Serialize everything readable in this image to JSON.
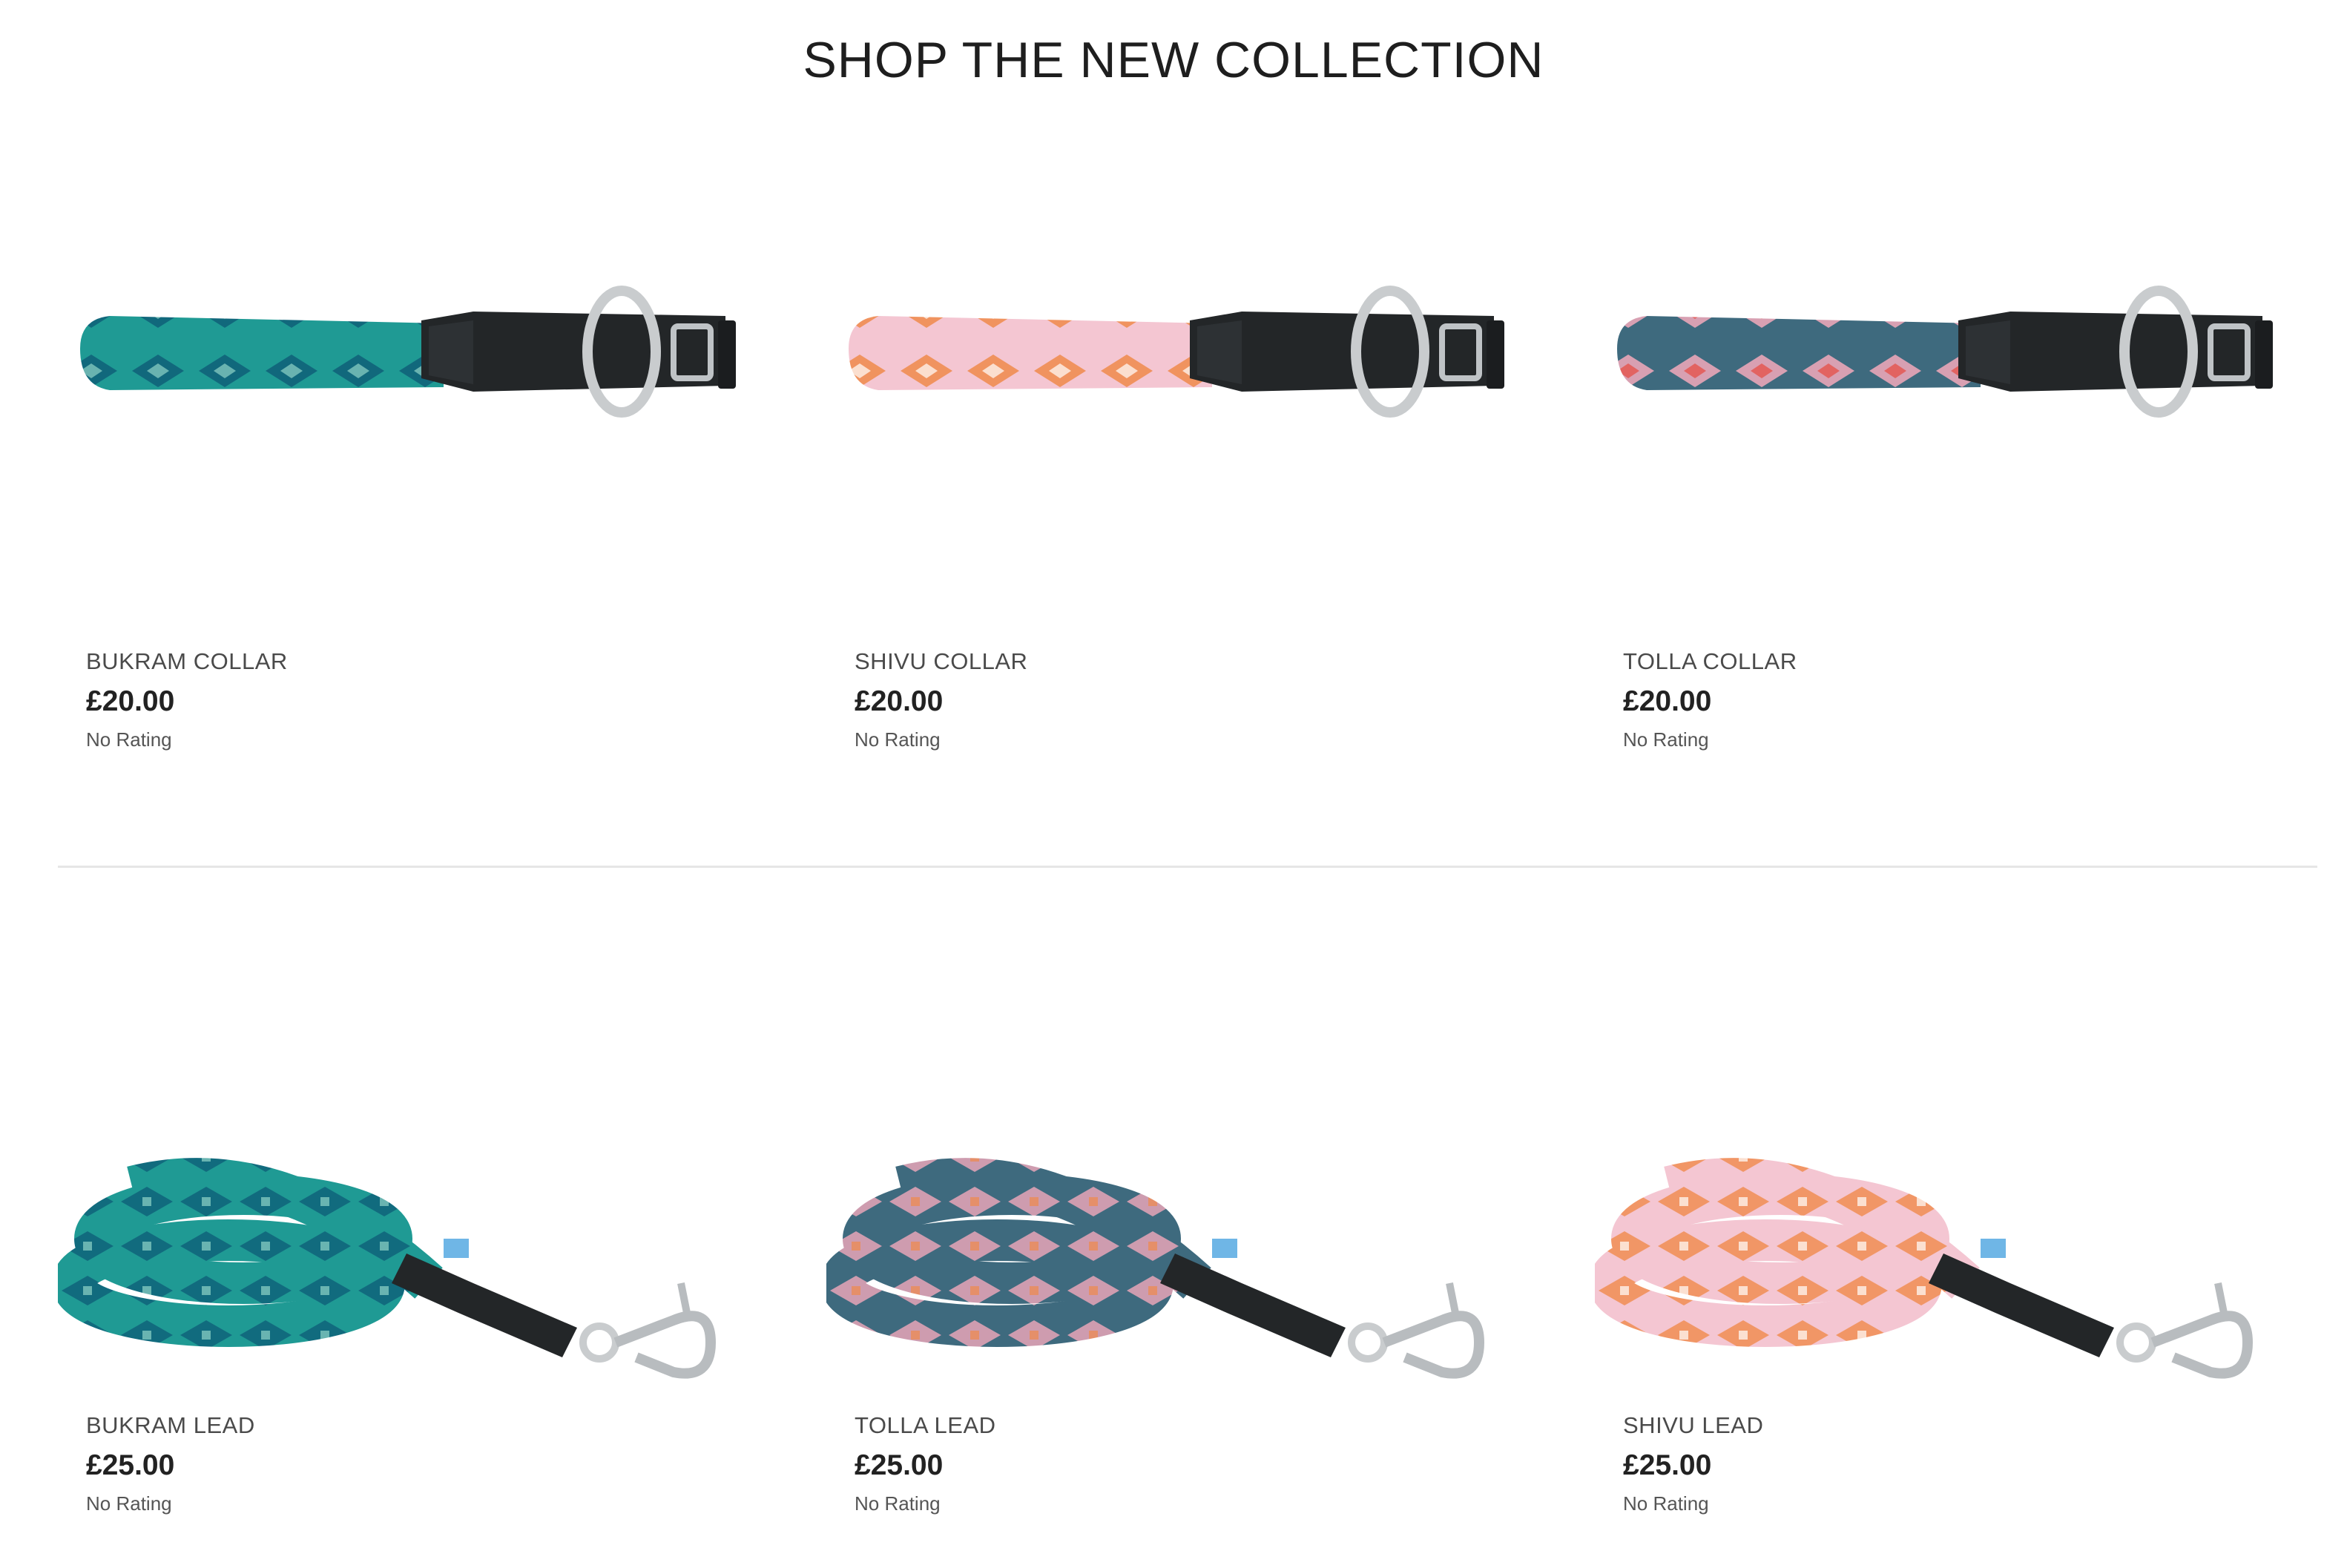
{
  "section": {
    "title": "SHOP THE NEW COLLECTION"
  },
  "products": [
    {
      "name": "BUKRAM COLLAR",
      "price": "£20.00",
      "rating": "No Rating",
      "type": "collar",
      "colors": {
        "fabric": "#1f9a94",
        "pattern": "#0e5f78",
        "accent": "#8fd3c6"
      }
    },
    {
      "name": "SHIVU COLLAR",
      "price": "£20.00",
      "rating": "No Rating",
      "type": "collar",
      "colors": {
        "fabric": "#f4c6d2",
        "pattern": "#f08a4b",
        "accent": "#ffffff"
      }
    },
    {
      "name": "TOLLA COLLAR",
      "price": "£20.00",
      "rating": "No Rating",
      "type": "collar",
      "colors": {
        "fabric": "#3e6a7e",
        "pattern": "#f3a9bb",
        "accent": "#e8493f"
      }
    },
    {
      "name": "BUKRAM LEAD",
      "price": "£25.00",
      "rating": "No Rating",
      "type": "lead",
      "colors": {
        "fabric": "#1f9a94",
        "pattern": "#0e5f78",
        "accent": "#8fd3c6"
      }
    },
    {
      "name": "TOLLA LEAD",
      "price": "£25.00",
      "rating": "No Rating",
      "type": "lead",
      "colors": {
        "fabric": "#3e6a7e",
        "pattern": "#f3a9bb",
        "accent": "#f08a4b"
      }
    },
    {
      "name": "SHIVU LEAD",
      "price": "£25.00",
      "rating": "No Rating",
      "type": "lead",
      "colors": {
        "fabric": "#f4c6d2",
        "pattern": "#f08a4b",
        "accent": "#ffffff"
      }
    }
  ]
}
